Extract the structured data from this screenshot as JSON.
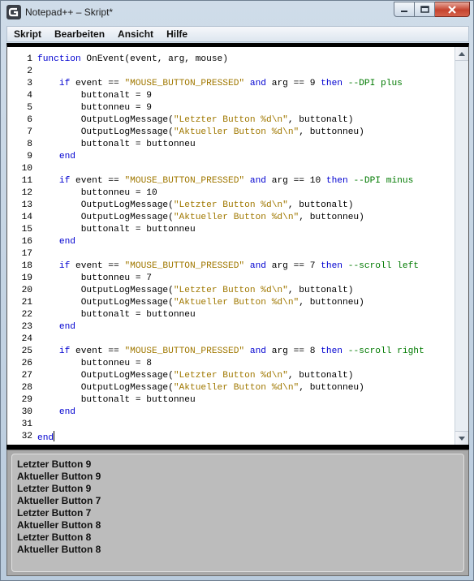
{
  "window": {
    "title": "Notepad++ – Skript*"
  },
  "menu": [
    "Skript",
    "Bearbeiten",
    "Ansicht",
    "Hilfe"
  ],
  "code_lines": [
    [
      {
        "t": "kw",
        "v": "function"
      },
      {
        "t": "p",
        "v": " OnEvent(event, arg, mouse)"
      }
    ],
    [],
    [
      {
        "t": "p",
        "v": "    "
      },
      {
        "t": "kw",
        "v": "if"
      },
      {
        "t": "p",
        "v": " event == "
      },
      {
        "t": "str",
        "v": "\"MOUSE_BUTTON_PRESSED\""
      },
      {
        "t": "p",
        "v": " "
      },
      {
        "t": "kw",
        "v": "and"
      },
      {
        "t": "p",
        "v": " arg == 9 "
      },
      {
        "t": "kw",
        "v": "then"
      },
      {
        "t": "p",
        "v": " "
      },
      {
        "t": "cmt",
        "v": "--DPI plus"
      }
    ],
    [
      {
        "t": "p",
        "v": "        buttonalt = 9"
      }
    ],
    [
      {
        "t": "p",
        "v": "        buttonneu = 9"
      }
    ],
    [
      {
        "t": "p",
        "v": "        OutputLogMessage("
      },
      {
        "t": "str",
        "v": "\"Letzter Button %d\\n\""
      },
      {
        "t": "p",
        "v": ", buttonalt)"
      }
    ],
    [
      {
        "t": "p",
        "v": "        OutputLogMessage("
      },
      {
        "t": "str",
        "v": "\"Aktueller Button %d\\n\""
      },
      {
        "t": "p",
        "v": ", buttonneu)"
      }
    ],
    [
      {
        "t": "p",
        "v": "        buttonalt = buttonneu"
      }
    ],
    [
      {
        "t": "p",
        "v": "    "
      },
      {
        "t": "kw",
        "v": "end"
      }
    ],
    [],
    [
      {
        "t": "p",
        "v": "    "
      },
      {
        "t": "kw",
        "v": "if"
      },
      {
        "t": "p",
        "v": " event == "
      },
      {
        "t": "str",
        "v": "\"MOUSE_BUTTON_PRESSED\""
      },
      {
        "t": "p",
        "v": " "
      },
      {
        "t": "kw",
        "v": "and"
      },
      {
        "t": "p",
        "v": " arg == 10 "
      },
      {
        "t": "kw",
        "v": "then"
      },
      {
        "t": "p",
        "v": " "
      },
      {
        "t": "cmt",
        "v": "--DPI minus"
      }
    ],
    [
      {
        "t": "p",
        "v": "        buttonneu = 10"
      }
    ],
    [
      {
        "t": "p",
        "v": "        OutputLogMessage("
      },
      {
        "t": "str",
        "v": "\"Letzter Button %d\\n\""
      },
      {
        "t": "p",
        "v": ", buttonalt)"
      }
    ],
    [
      {
        "t": "p",
        "v": "        OutputLogMessage("
      },
      {
        "t": "str",
        "v": "\"Aktueller Button %d\\n\""
      },
      {
        "t": "p",
        "v": ", buttonneu)"
      }
    ],
    [
      {
        "t": "p",
        "v": "        buttonalt = buttonneu"
      }
    ],
    [
      {
        "t": "p",
        "v": "    "
      },
      {
        "t": "kw",
        "v": "end"
      }
    ],
    [],
    [
      {
        "t": "p",
        "v": "    "
      },
      {
        "t": "kw",
        "v": "if"
      },
      {
        "t": "p",
        "v": " event == "
      },
      {
        "t": "str",
        "v": "\"MOUSE_BUTTON_PRESSED\""
      },
      {
        "t": "p",
        "v": " "
      },
      {
        "t": "kw",
        "v": "and"
      },
      {
        "t": "p",
        "v": " arg == 7 "
      },
      {
        "t": "kw",
        "v": "then"
      },
      {
        "t": "p",
        "v": " "
      },
      {
        "t": "cmt",
        "v": "--scroll left"
      }
    ],
    [
      {
        "t": "p",
        "v": "        buttonneu = 7"
      }
    ],
    [
      {
        "t": "p",
        "v": "        OutputLogMessage("
      },
      {
        "t": "str",
        "v": "\"Letzter Button %d\\n\""
      },
      {
        "t": "p",
        "v": ", buttonalt)"
      }
    ],
    [
      {
        "t": "p",
        "v": "        OutputLogMessage("
      },
      {
        "t": "str",
        "v": "\"Aktueller Button %d\\n\""
      },
      {
        "t": "p",
        "v": ", buttonneu)"
      }
    ],
    [
      {
        "t": "p",
        "v": "        buttonalt = buttonneu"
      }
    ],
    [
      {
        "t": "p",
        "v": "    "
      },
      {
        "t": "kw",
        "v": "end"
      }
    ],
    [],
    [
      {
        "t": "p",
        "v": "    "
      },
      {
        "t": "kw",
        "v": "if"
      },
      {
        "t": "p",
        "v": " event == "
      },
      {
        "t": "str",
        "v": "\"MOUSE_BUTTON_PRESSED\""
      },
      {
        "t": "p",
        "v": " "
      },
      {
        "t": "kw",
        "v": "and"
      },
      {
        "t": "p",
        "v": " arg == 8 "
      },
      {
        "t": "kw",
        "v": "then"
      },
      {
        "t": "p",
        "v": " "
      },
      {
        "t": "cmt",
        "v": "--scroll right"
      }
    ],
    [
      {
        "t": "p",
        "v": "        buttonneu = 8"
      }
    ],
    [
      {
        "t": "p",
        "v": "        OutputLogMessage("
      },
      {
        "t": "str",
        "v": "\"Letzter Button %d\\n\""
      },
      {
        "t": "p",
        "v": ", buttonalt)"
      }
    ],
    [
      {
        "t": "p",
        "v": "        OutputLogMessage("
      },
      {
        "t": "str",
        "v": "\"Aktueller Button %d\\n\""
      },
      {
        "t": "p",
        "v": ", buttonneu)"
      }
    ],
    [
      {
        "t": "p",
        "v": "        buttonalt = buttonneu"
      }
    ],
    [
      {
        "t": "p",
        "v": "    "
      },
      {
        "t": "kw",
        "v": "end"
      }
    ],
    [],
    [
      {
        "t": "kw",
        "v": "end"
      }
    ]
  ],
  "output_lines": [
    "Letzter Button 9",
    "Aktueller Button 9",
    "Letzter Button 9",
    "Aktueller Button 7",
    "Letzter Button 7",
    "Aktueller Button 8",
    "Letzter Button 8",
    "Aktueller Button 8"
  ],
  "icons": {
    "app": "logitech-g-icon",
    "minimize": "minimize-icon",
    "maximize": "maximize-icon",
    "close": "close-icon",
    "scroll_up": "scroll-up-arrow-icon",
    "scroll_down": "scroll-down-arrow-icon"
  },
  "colors": {
    "keyword": "#0000d0",
    "string": "#a07800",
    "comment": "#007a00",
    "close_button": "#c5432f"
  }
}
